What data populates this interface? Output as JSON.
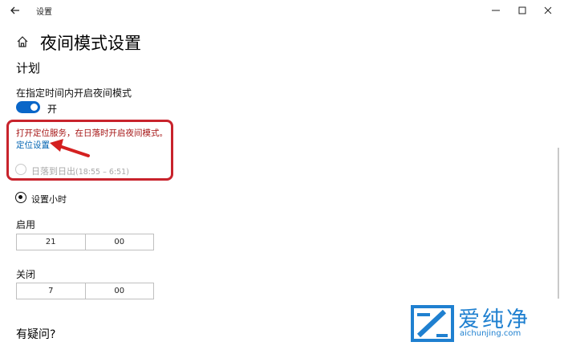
{
  "window": {
    "title": "设置"
  },
  "page": {
    "title": "夜间模式设置",
    "section": "计划"
  },
  "schedule": {
    "toggle_label": "在指定时间内开启夜间模式",
    "toggle_state": "开",
    "toggle_on": true,
    "location_warning": "打开定位服务，在日落时开启夜间模式。",
    "location_link": "定位设置",
    "sunset_option_label": "日落到日出",
    "sunset_option_range": "(18:55 – 6:51)",
    "set_hours_label": "设置小时"
  },
  "on_time": {
    "label": "启用",
    "hour": "21",
    "minute": "00"
  },
  "off_time": {
    "label": "关闭",
    "hour": "7",
    "minute": "00"
  },
  "faq": {
    "title": "有疑问?"
  },
  "watermark": {
    "brand": "爱纯净",
    "url": "aichunjing.com"
  },
  "colors": {
    "accent": "#0a66c8",
    "highlight": "#c8232c",
    "warning": "#a51414",
    "link": "#0063b1"
  },
  "icons": [
    "back-arrow-icon",
    "minimize-icon",
    "maximize-icon",
    "close-icon",
    "home-icon"
  ]
}
